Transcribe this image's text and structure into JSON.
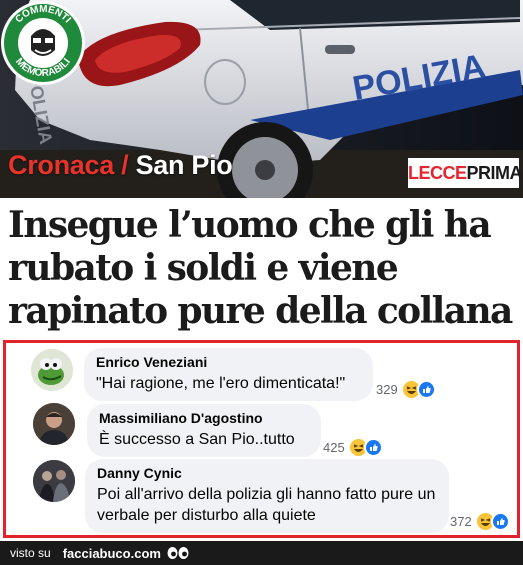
{
  "hero": {
    "category": "Cronaca",
    "separator": " / ",
    "subcategory": "San Pio",
    "source_logo_part1": "LECCE",
    "source_logo_part2": "PRIMA",
    "car_lettering": "POLIZIA",
    "badge": {
      "top_text": "COMMENTI",
      "bottom_text": "MEMORABILI"
    }
  },
  "headline": "Insegue l’uomo che gli ha rubato i soldi e viene rapinato pure della collana",
  "comments": [
    {
      "author": "Enrico Veneziani",
      "text": "\"Hai ragione, me l'ero dimenticata!\"",
      "reactions_count": "329",
      "avatar": "kermit-avatar"
    },
    {
      "author": "Massimiliano D'agostino",
      "text": "È successo a San Pio..tutto",
      "reactions_count": "425",
      "avatar": "person-avatar"
    },
    {
      "author": "Danny Cynic",
      "text": "Poi all'arrivo della polizia gli hanno fatto pure un verbale per disturbo alla quiete",
      "reactions_count": "372",
      "avatar": "band-avatar"
    }
  ],
  "footer": {
    "seen_on": "visto su",
    "site": "facciabuco.com"
  },
  "colors": {
    "accent_red": "#e1242c",
    "category_red": "#e8332b",
    "bubble_bg": "#f0f2f5",
    "badge_green": "#1f8a3c"
  }
}
